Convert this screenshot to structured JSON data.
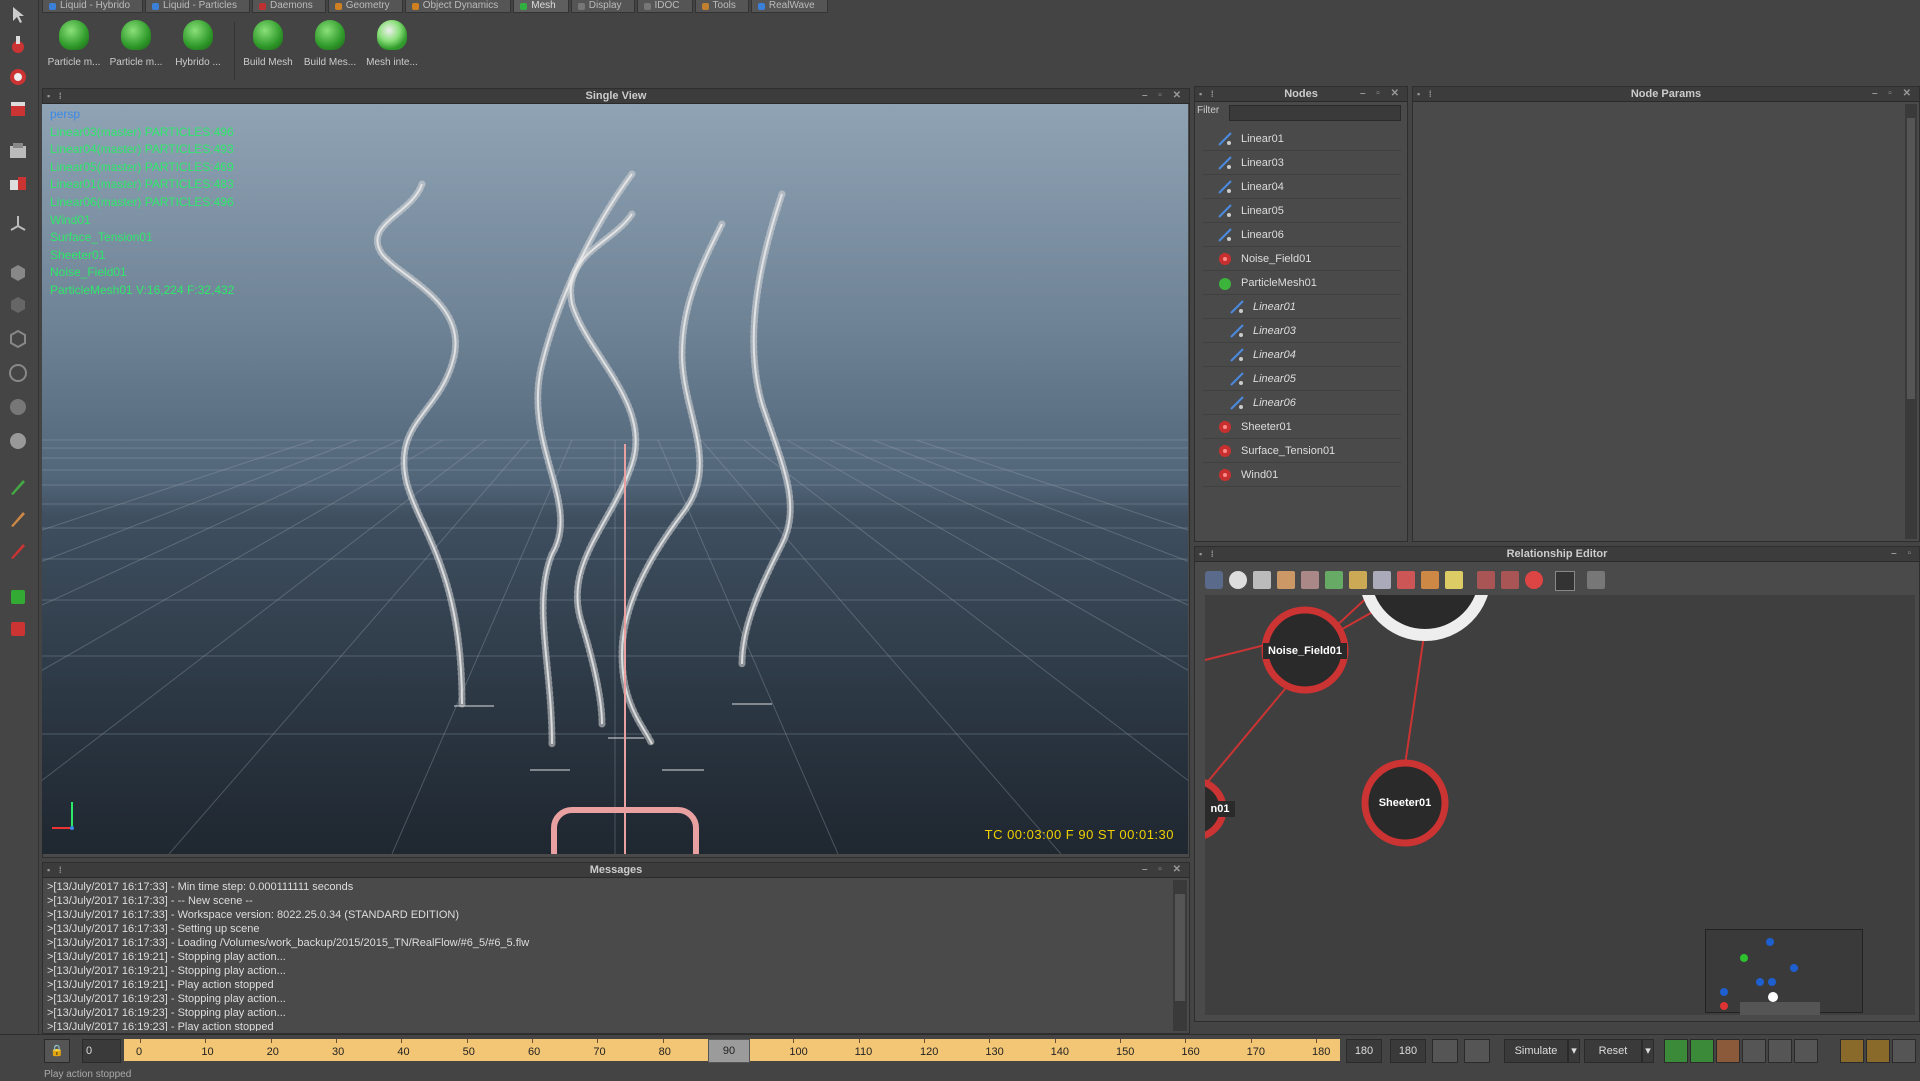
{
  "tabs": [
    {
      "label": "Liquid - Hybrido",
      "color": "#3a7fd8"
    },
    {
      "label": "Liquid - Particles",
      "color": "#3a7fd8"
    },
    {
      "label": "Daemons",
      "color": "#c03030"
    },
    {
      "label": "Geometry",
      "color": "#d08020"
    },
    {
      "label": "Object Dynamics",
      "color": "#d08020"
    },
    {
      "label": "Mesh",
      "color": "#30b040"
    },
    {
      "label": "Display",
      "color": "#777"
    },
    {
      "label": "IDOC",
      "color": "#777"
    },
    {
      "label": "Tools",
      "color": "#c08030"
    },
    {
      "label": "RealWave",
      "color": "#3a7fd8"
    }
  ],
  "shelf": [
    {
      "label": "Particle m..."
    },
    {
      "label": "Particle m..."
    },
    {
      "label": "Hybrido ..."
    },
    {
      "label": "Build Mesh"
    },
    {
      "label": "Build Mes..."
    },
    {
      "label": "Mesh inte..."
    }
  ],
  "viewport": {
    "title": "Single View",
    "overlay": [
      {
        "text": "persp",
        "color": "#3a8ae8"
      },
      {
        "text": "Linear03(master) PARTICLES:496",
        "color": "#2ee86a"
      },
      {
        "text": "Linear04(master) PARTICLES:493",
        "color": "#2ee86a"
      },
      {
        "text": "Linear05(master) PARTICLES:469",
        "color": "#2ee86a"
      },
      {
        "text": "Linear01(master) PARTICLES:483",
        "color": "#2ee86a"
      },
      {
        "text": "Linear06(master) PARTICLES:496",
        "color": "#2ee86a"
      },
      {
        "text": "Wind01",
        "color": "#2ee86a"
      },
      {
        "text": "Surface_Tension01",
        "color": "#2ee86a"
      },
      {
        "text": "Sheeter01",
        "color": "#2ee86a"
      },
      {
        "text": "Noise_Field01",
        "color": "#2ee86a"
      },
      {
        "text": "ParticleMesh01 V:16,224 F:32,432",
        "color": "#2ee86a"
      }
    ],
    "timecode": "TC 00:03:00   F 90   ST 00:01:30"
  },
  "messages": {
    "title": "Messages",
    "lines": [
      ">[13/July/2017 16:17:33] - Min time step: 0.000111111 seconds",
      ">[13/July/2017 16:17:33] - -- New scene --",
      ">[13/July/2017 16:17:33] - Workspace version: 8022.25.0.34 (STANDARD EDITION)",
      ">[13/July/2017 16:17:33] - Setting up scene",
      ">[13/July/2017 16:17:33] -  Loading /Volumes/work_backup/2015/2015_TN/RealFlow/#6_5/#6_5.flw",
      ">[13/July/2017 16:19:21] - Stopping play action...",
      ">[13/July/2017 16:19:21] - Stopping play action...",
      ">[13/July/2017 16:19:21] - Play action stopped",
      ">[13/July/2017 16:19:23] - Stopping play action...",
      ">[13/July/2017 16:19:23] - Stopping play action...",
      ">[13/July/2017 16:19:23] - Play action stopped"
    ]
  },
  "nodes": {
    "title": "Nodes",
    "filter_label": "Filter",
    "items": [
      {
        "label": "Linear01",
        "type": "emitter",
        "child": false
      },
      {
        "label": "Linear03",
        "type": "emitter",
        "child": false
      },
      {
        "label": "Linear04",
        "type": "emitter",
        "child": false
      },
      {
        "label": "Linear05",
        "type": "emitter",
        "child": false
      },
      {
        "label": "Linear06",
        "type": "emitter",
        "child": false
      },
      {
        "label": "Noise_Field01",
        "type": "daemon",
        "child": false
      },
      {
        "label": "ParticleMesh01",
        "type": "mesh",
        "child": false
      },
      {
        "label": "Linear01",
        "type": "emitter",
        "child": true
      },
      {
        "label": "Linear03",
        "type": "emitter",
        "child": true
      },
      {
        "label": "Linear04",
        "type": "emitter",
        "child": true
      },
      {
        "label": "Linear05",
        "type": "emitter",
        "child": true
      },
      {
        "label": "Linear06",
        "type": "emitter",
        "child": true
      },
      {
        "label": "Sheeter01",
        "type": "daemon",
        "child": false
      },
      {
        "label": "Surface_Tension01",
        "type": "daemon",
        "child": false
      },
      {
        "label": "Wind01",
        "type": "daemon",
        "child": false
      }
    ]
  },
  "params": {
    "title": "Node Params"
  },
  "relationship": {
    "title": "Relationship Editor",
    "nodes": [
      "Noise_Field01",
      "Sheeter01",
      "n01"
    ]
  },
  "timeline": {
    "start": "0",
    "current": "90",
    "end": "180",
    "end2": "180",
    "ticks": [
      "0",
      "10",
      "20",
      "30",
      "40",
      "50",
      "60",
      "70",
      "80",
      "90",
      "100",
      "110",
      "120",
      "130",
      "140",
      "150",
      "160",
      "170",
      "180"
    ],
    "simulate_label": "Simulate",
    "reset_label": "Reset"
  },
  "status": "Play action stopped"
}
